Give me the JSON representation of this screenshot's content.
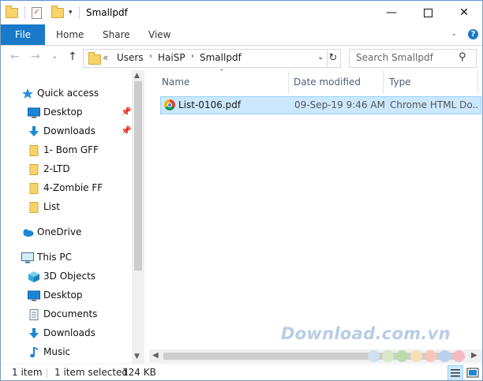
{
  "window": {
    "title": "Smallpdf",
    "minimize_glyph": "—",
    "close_glyph": "✕"
  },
  "ribbon": {
    "tabs": [
      "File",
      "Home",
      "Share",
      "View"
    ],
    "expand_glyph": "⌄"
  },
  "address": {
    "prefix": "«",
    "crumbs": [
      "Users",
      "HaiSP",
      "Smallpdf"
    ],
    "separator": "›",
    "dropdown_glyph": "⌄",
    "refresh_glyph": "↻"
  },
  "search": {
    "placeholder": "Search Smallpdf",
    "icon": "search-icon",
    "glyph": "⚲"
  },
  "nav_buttons": {
    "back": "←",
    "forward": "→",
    "recent": "⌄",
    "up": "↑"
  },
  "nav": {
    "quick_access": "Quick access",
    "pinned": [
      {
        "label": "Desktop",
        "icon": "desktop-icon"
      },
      {
        "label": "Downloads",
        "icon": "downloads-icon"
      }
    ],
    "folders": [
      "1- Bom GFF",
      "2-LTD",
      "4-Zombie FF",
      "List"
    ],
    "onedrive": "OneDrive",
    "this_pc": "This PC",
    "pc_items": [
      {
        "label": "3D Objects",
        "icon": "3d-objects-icon"
      },
      {
        "label": "Desktop",
        "icon": "desktop-icon"
      },
      {
        "label": "Documents",
        "icon": "documents-icon"
      },
      {
        "label": "Downloads",
        "icon": "downloads-icon"
      },
      {
        "label": "Music",
        "icon": "music-icon"
      }
    ]
  },
  "columns": {
    "name": "Name",
    "date": "Date modified",
    "type": "Type"
  },
  "files": [
    {
      "name": "List-0106.pdf",
      "date": "09-Sep-19 9:46 AM",
      "type": "Chrome HTML Do...",
      "icon": "chrome-icon",
      "selected": true
    }
  ],
  "status": {
    "count": "1 item",
    "selection": "1 item selected",
    "size": "124 KB"
  },
  "watermark": {
    "text": "Download.com.vn",
    "dot_colors": [
      "#cfe0f0",
      "#d7e9c7",
      "#b9dca9",
      "#f6dfb5",
      "#f7c5b8",
      "#b9d1ee",
      "#f4b9c2"
    ]
  },
  "colors": {
    "accent": "#1979ca",
    "selection": "#cce8ff",
    "selection_border": "#99d1ff",
    "header_text": "#4c607a"
  }
}
